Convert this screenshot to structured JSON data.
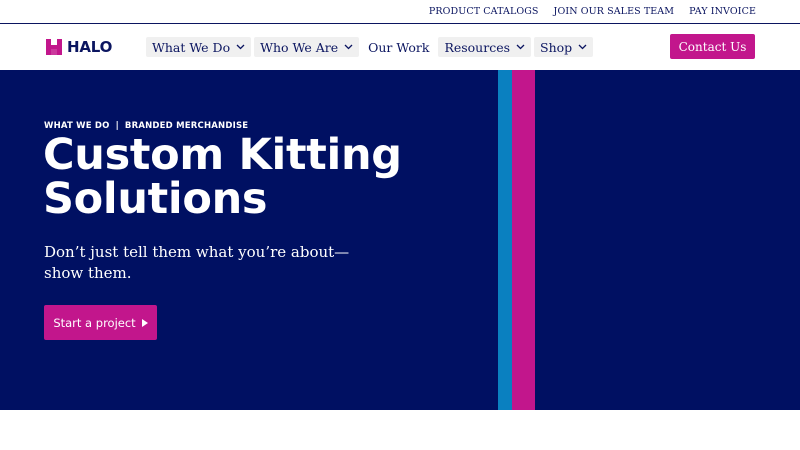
{
  "utility_nav": {
    "links": [
      "PRODUCT CATALOGS",
      "JOIN OUR SALES TEAM",
      "PAY INVOICE"
    ]
  },
  "header": {
    "logo_text": "HALO",
    "nav": [
      {
        "label": "What We Do",
        "dropdown": true
      },
      {
        "label": "Who We Are",
        "dropdown": true
      },
      {
        "label": "Our Work",
        "dropdown": false
      },
      {
        "label": "Resources",
        "dropdown": true
      },
      {
        "label": "Shop",
        "dropdown": true
      }
    ],
    "contact_label": "Contact Us"
  },
  "hero": {
    "breadcrumb": [
      "WHAT WE DO",
      "BRANDED MERCHANDISE"
    ],
    "breadcrumb_separator": "|",
    "title_line1": "Custom Kitting",
    "title_line2": "Solutions",
    "subtitle": "Don’t just tell them what you’re about—show them.",
    "cta_label": "Start a project"
  },
  "colors": {
    "navy": "#001062",
    "text_navy": "#0b1560",
    "magenta": "#c2168c",
    "blue": "#0a80c0",
    "nav_bg": "#f0f0f0"
  },
  "icons": {
    "logo": "halo-logo-icon",
    "dropdown": "chevron-down-icon",
    "cta": "play-arrow-icon"
  }
}
